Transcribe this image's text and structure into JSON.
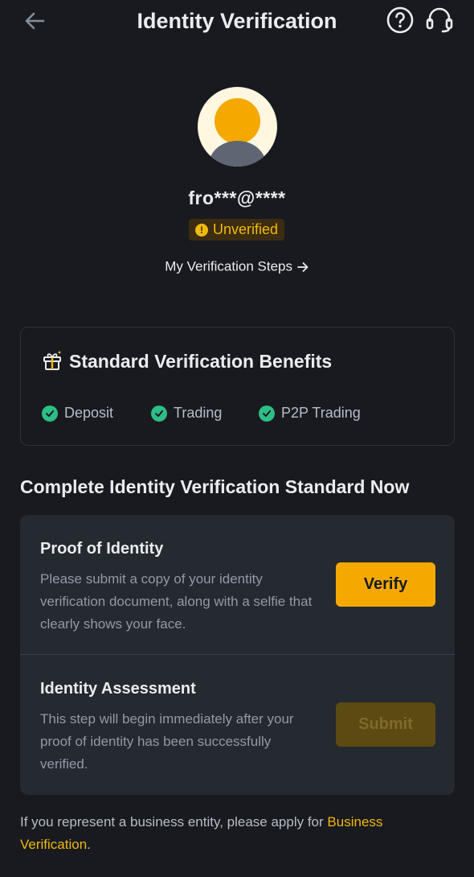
{
  "header": {
    "title": "Identity Verification"
  },
  "profile": {
    "user_id": "fro***@****",
    "status": "Unverified",
    "steps_link": "My Verification Steps"
  },
  "benefits": {
    "title": "Standard Verification Benefits",
    "items": [
      "Deposit",
      "Trading",
      "P2P Trading"
    ]
  },
  "section": {
    "title": "Complete Identity Verification Standard Now"
  },
  "steps": [
    {
      "title": "Proof of Identity",
      "description": "Please submit a copy of your identity verification document, along with a selfie that clearly shows your face.",
      "button": "Verify"
    },
    {
      "title": "Identity Assessment",
      "description": "This step will begin immediately after your proof of identity has been successfully verified.",
      "button": "Submit"
    }
  ],
  "footer": {
    "text": "If you represent a business entity, please apply for",
    "link": "Business Verification",
    "suffix": "."
  },
  "colors": {
    "background": "#181A20",
    "accent": "#F0B90B",
    "success": "#2EBD85"
  },
  "icons": {
    "back": "arrow-left-icon",
    "help": "question-circle-icon",
    "support": "headset-icon",
    "gift": "gift-icon",
    "check": "check-circle-icon",
    "warning": "exclamation-circle-icon"
  }
}
